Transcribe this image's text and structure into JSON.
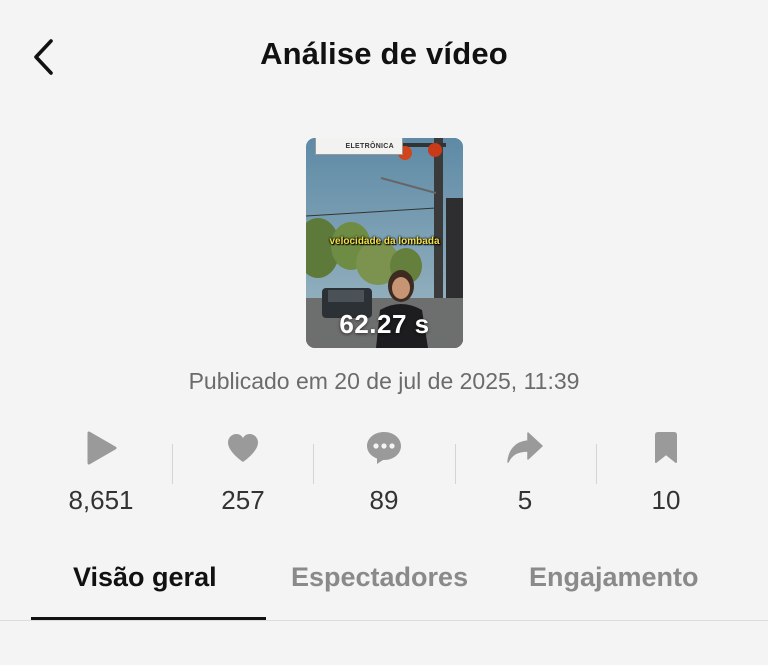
{
  "header": {
    "title": "Análise de vídeo",
    "back_icon": "chevron-left-icon"
  },
  "video": {
    "sign_text": "ELETRÔNICA",
    "caption": "velocidade da lombada",
    "duration": "62.27 s",
    "published": "Publicado em 20 de jul de 2025, 11:39"
  },
  "stats": [
    {
      "icon": "play-icon",
      "value": "8,651"
    },
    {
      "icon": "heart-icon",
      "value": "257"
    },
    {
      "icon": "comment-icon",
      "value": "89"
    },
    {
      "icon": "share-icon",
      "value": "5"
    },
    {
      "icon": "bookmark-icon",
      "value": "10"
    }
  ],
  "tabs": [
    {
      "label": "Visão geral",
      "active": true
    },
    {
      "label": "Espectadores",
      "active": false
    },
    {
      "label": "Engajamento",
      "active": false
    }
  ],
  "colors": {
    "background": "#f4f4f4",
    "icon_gray": "#9a9a9a",
    "text_dark": "#111111",
    "text_muted": "#8a8a8a"
  }
}
